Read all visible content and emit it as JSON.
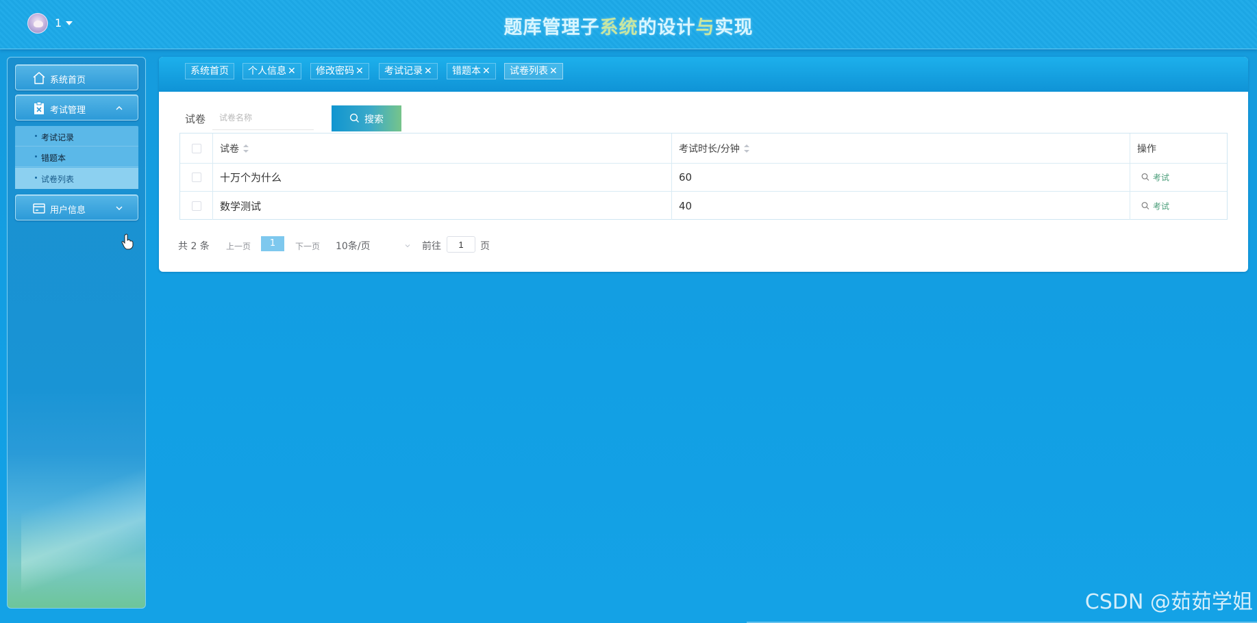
{
  "header": {
    "title_part1": "题库管理子",
    "title_part2": "系统",
    "title_part3": "的设计",
    "title_part4": "与",
    "title_part5": "实现",
    "user_name": "1"
  },
  "sidebar": {
    "items": [
      {
        "label": "系统首页",
        "icon": "home-icon"
      },
      {
        "label": "考试管理",
        "icon": "clipboard-icon",
        "expanded": true
      },
      {
        "label": "用户信息",
        "icon": "card-icon",
        "expanded": false
      }
    ],
    "submenu": [
      {
        "label": "考试记录"
      },
      {
        "label": "错题本"
      },
      {
        "label": "试卷列表",
        "active": true
      }
    ]
  },
  "tabs": [
    {
      "label": "系统首页",
      "closable": false
    },
    {
      "label": "个人信息",
      "closable": true
    },
    {
      "label": "修改密码",
      "closable": true
    },
    {
      "label": "考试记录",
      "closable": true
    },
    {
      "label": "错题本",
      "closable": true
    },
    {
      "label": "试卷列表",
      "closable": true,
      "active": true
    }
  ],
  "tab_close_glyph": "✕",
  "search": {
    "label": "试卷",
    "placeholder": "试卷名称",
    "value": "",
    "button_label": "搜索"
  },
  "table": {
    "columns": [
      "试卷",
      "考试时长/分钟",
      "操作"
    ],
    "rows": [
      {
        "name": "十万个为什么",
        "duration": "60",
        "action": "考试"
      },
      {
        "name": "数学测试",
        "duration": "40",
        "action": "考试"
      }
    ]
  },
  "pagination": {
    "total_text": "共 2 条",
    "prev_label": "上一页",
    "current_page": "1",
    "next_label": "下一页",
    "page_size": "10条/页",
    "goto_label": "前往",
    "goto_value": "1",
    "goto_unit": "页"
  },
  "watermark": "CSDN @茹茹学姐",
  "colors": {
    "accent": "#129fe4",
    "search_button_start": "#1095d0",
    "search_button_end": "#76c48a",
    "link_green": "#4b9e7a",
    "page_active": "#7ec8ee"
  }
}
